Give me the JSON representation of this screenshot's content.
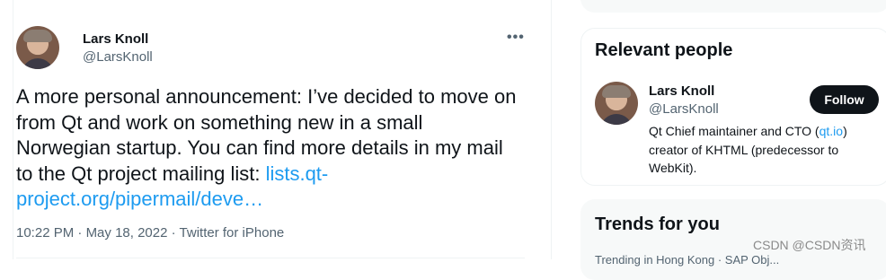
{
  "tweet": {
    "author_name": "Lars Knoll",
    "author_handle": "@LarsKnoll",
    "more_icon": "more-horizontal-icon",
    "text_before_link": "A more personal announcement: I’ve decided to move on from Qt and work on something new in a small Norwegian startup. You can find more details in my mail to the Qt project mailing list: ",
    "link_text": "lists.qt-project.org/pipermail/deve…",
    "time": "10:22 PM",
    "date": "May 18, 2022",
    "source": "Twitter for iPhone",
    "separator": "·"
  },
  "sidebar": {
    "relevant_people": {
      "title": "Relevant people",
      "name": "Lars Knoll",
      "handle": "@LarsKnoll",
      "follow_label": "Follow",
      "bio_before_link": "Qt Chief maintainer and CTO (",
      "bio_link": "qt.io",
      "bio_after_link": ") creator of KHTML (predecessor to WebKit)."
    },
    "trends": {
      "title": "Trends for you",
      "peek_text": "Trending in Hong Kong · SAP Obj..."
    }
  },
  "watermark": "CSDN @CSDN资讯",
  "colors": {
    "accent_link": "#1d9bf0",
    "text_primary": "#0f1419",
    "text_secondary": "#536471",
    "follow_button_bg": "#0f1419"
  }
}
